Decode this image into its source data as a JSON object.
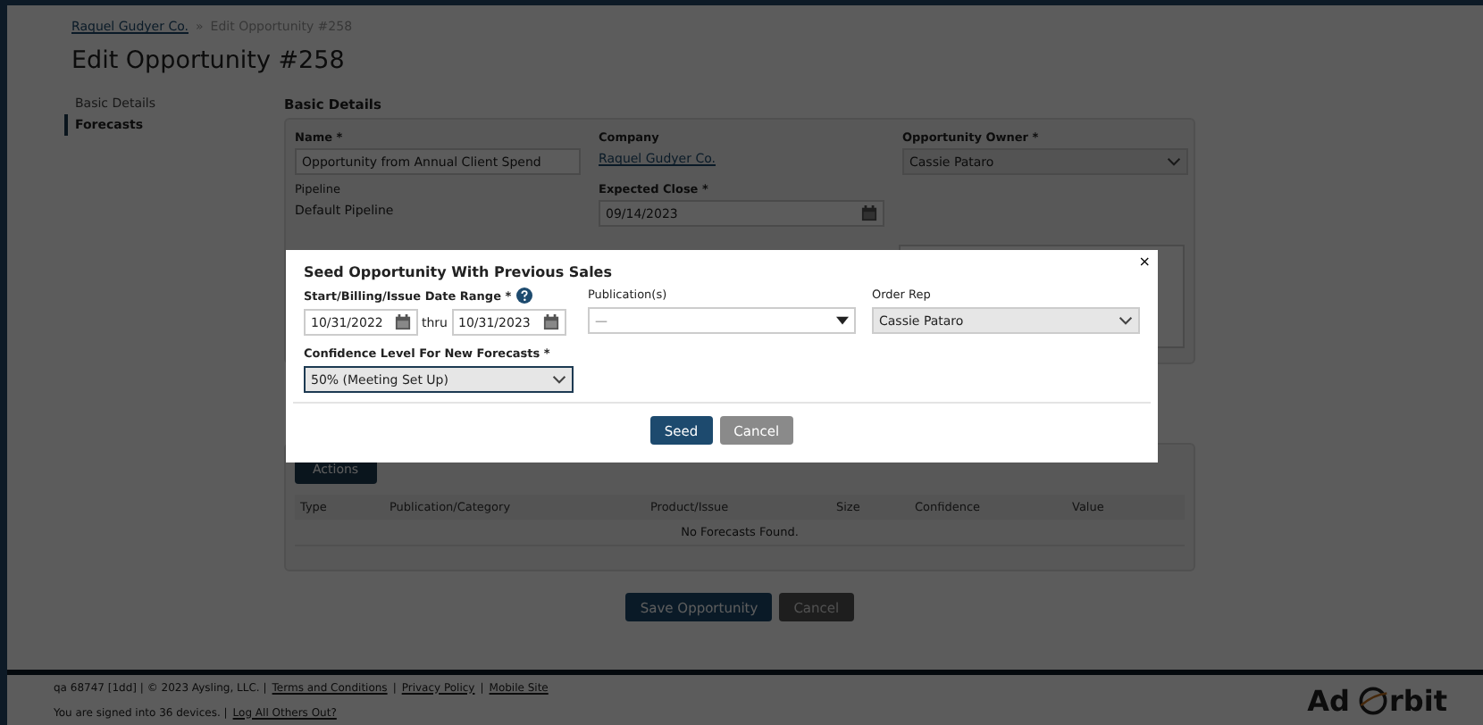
{
  "breadcrumb": {
    "link": "Raquel Gudyer Co.",
    "separator": "»",
    "current": "Edit Opportunity #258"
  },
  "title": "Edit Opportunity #258",
  "sidebar": {
    "items": [
      {
        "label": "Basic Details",
        "selected": false
      },
      {
        "label": "Forecasts",
        "selected": true
      }
    ]
  },
  "basic_details": {
    "heading": "Basic Details",
    "name": {
      "label": "Name *",
      "value": "Opportunity from Annual Client Spend"
    },
    "company": {
      "label": "Company",
      "value": "Raquel Gudyer Co."
    },
    "owner": {
      "label": "Opportunity Owner *",
      "value": "Cassie Pataro"
    },
    "pipeline": {
      "label": "Pipeline",
      "value": "Default Pipeline"
    },
    "expected_close": {
      "label": "Expected Close *",
      "value": "09/14/2023"
    }
  },
  "forecasts": {
    "actions_button": "Actions",
    "table": {
      "columns": [
        "Type",
        "Publication/Category",
        "Product/Issue",
        "Size",
        "Confidence",
        "Value"
      ],
      "empty_message": "No Forecasts Found."
    }
  },
  "buttons": [
    "Save Opportunity",
    "Cancel"
  ],
  "footer": {
    "line1": {
      "text": "qa 68747 [1dd] | © 2023 Aysling, LLC. |",
      "links": [
        "Terms and Conditions",
        "Privacy Policy",
        "Mobile Site"
      ],
      "separator": "|"
    },
    "line2": {
      "text": "You are signed into 36 devices. |",
      "links": [
        "Log All Others Out?"
      ]
    },
    "logo": {
      "left": "Ad",
      "right": "rbit"
    }
  },
  "modal": {
    "title": "Seed Opportunity With Previous Sales",
    "close": "×",
    "date_range": {
      "label": "Start/Billing/Issue Date Range *",
      "start": "10/31/2022",
      "thru": "thru",
      "end": "10/31/2023"
    },
    "publications": {
      "label": "Publication(s)",
      "value": "—"
    },
    "order_rep": {
      "label": "Order Rep",
      "value": "Cassie Pataro"
    },
    "confidence": {
      "label": "Confidence Level For New Forecasts *",
      "value": "50% (Meeting Set Up)"
    },
    "buttons": [
      "Seed",
      "Cancel"
    ]
  }
}
